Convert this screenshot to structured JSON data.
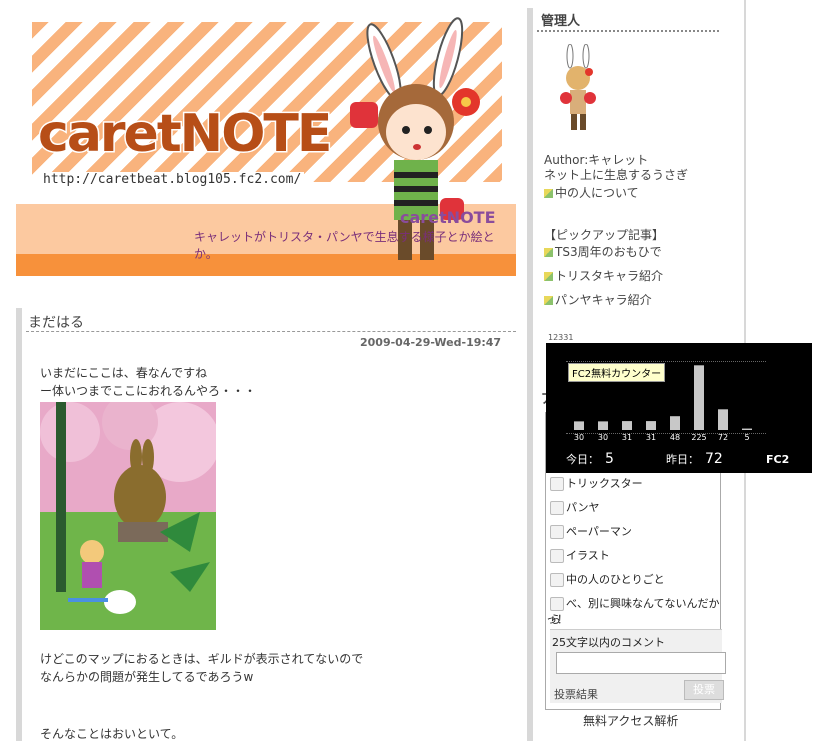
{
  "banner": {
    "logo_text": "caretNOTE",
    "url": "http://caretbeat.blog105.fc2.com/",
    "mini_logo": "caretNOTE",
    "tagline": "キャレットがトリスタ・パンヤで生息する様子とか絵とか。"
  },
  "post": {
    "title": "まだはる",
    "date": "2009-04-29-Wed-19:47",
    "para1_line1": "いまだにここは、春なんですね",
    "para1_line2": "ー体いつまでここにおれるんやろ・・・",
    "para2_line1": "けどこのマップにおるときは、ギルドが表示されてないので",
    "para2_line2": "なんらかの問題が発生してるであろうw",
    "para3": "そんなことはおいといて。"
  },
  "sidebar": {
    "admin_title": "管理人",
    "author_line": "Author:キャレット",
    "author_desc": "ネット上に生息するうさぎ",
    "about_link": "中の人について",
    "pickup_title": "【ピックアップ記事】",
    "pickup_items": [
      {
        "label": "TS3周年のおもひで"
      },
      {
        "label": "トリスタキャラ紹介"
      },
      {
        "label": "パンヤキャラ紹介"
      }
    ],
    "counter_number": "12331",
    "poll_section_title": "ア"
  },
  "poll": {
    "options": [
      {
        "label": "トリックスター"
      },
      {
        "label": "パンヤ"
      },
      {
        "label": "ペーパーマン"
      },
      {
        "label": "イラスト"
      },
      {
        "label": "中の人のひとりごと"
      },
      {
        "label": "べ、別に興味なんてないんだから"
      },
      {
        "label": "っ！"
      }
    ],
    "comment_label": "25文字以内のコメント",
    "comment_value": "",
    "results_label": "投票結果",
    "vote_button": "投票",
    "access_label": "無料アクセス解析"
  },
  "fc2_counter": {
    "label": "FC2無料カウンター",
    "today_label": "今日：",
    "today_value": "5",
    "yesterday_label": "昨日：",
    "yesterday_value": "72",
    "logo": "FC2"
  },
  "chart_data": {
    "type": "bar",
    "categories": [
      "",
      "",
      "",
      "",
      "",
      "",
      "",
      ""
    ],
    "values": [
      30,
      30,
      31,
      31,
      48,
      225,
      72,
      5
    ],
    "value_labels": [
      "30",
      "30",
      "31",
      "31",
      "48",
      "225",
      "72",
      "5"
    ],
    "ylim": [
      0,
      240
    ],
    "grid": true,
    "colors": {
      "bar": "#c8c8c8",
      "background": "#000000"
    }
  },
  "colors": {
    "stripe": "#f9b37d",
    "band": "#fcc9a0",
    "band_dark": "#f7913b",
    "logo": "#b74e17",
    "poll_head": "#4f7b7f"
  }
}
